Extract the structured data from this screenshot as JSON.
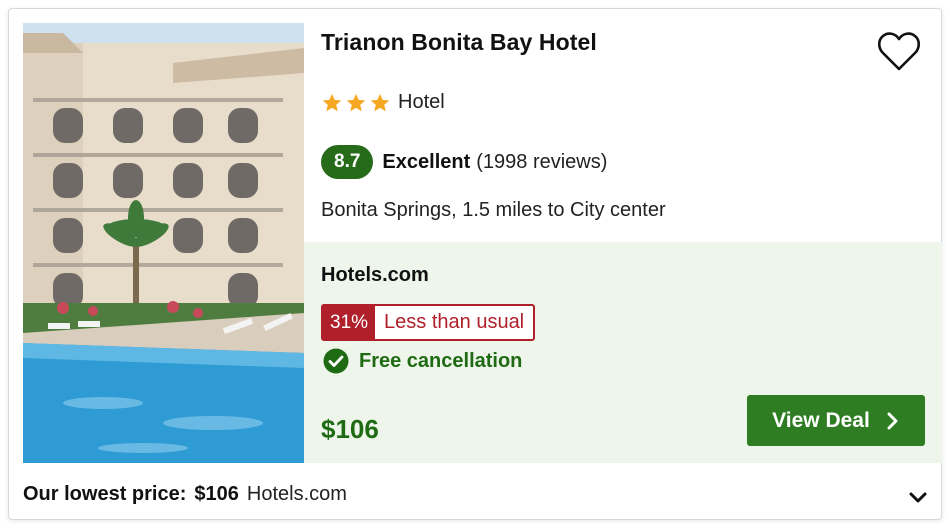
{
  "hotel": {
    "name": "Trianon Bonita Bay Hotel",
    "star_rating": 3,
    "type": "Hotel",
    "score": "8.7",
    "rating_word": "Excellent",
    "reviews": "(1998 reviews)",
    "location": "Bonita Springs, 1.5 miles to City center"
  },
  "deal": {
    "provider": "Hotels.com",
    "discount_pct": "31%",
    "discount_label": "Less than usual",
    "free_cancellation": "Free cancellation",
    "price": "$106",
    "view_deal_label": "View Deal"
  },
  "footer": {
    "lowest_label": "Our lowest price:",
    "lowest_price": "$106",
    "lowest_provider": "Hotels.com"
  },
  "icons": {
    "favorite": "heart-outline-icon",
    "star": "star-icon",
    "check": "check-circle-icon",
    "chevron_right": "chevron-right-icon",
    "chevron_down": "chevron-down-icon"
  },
  "colors": {
    "score_bg": "#256b1a",
    "accent_green": "#1f6b14",
    "button_green": "#2f7d22",
    "deal_bg": "#eef5ea",
    "discount_red": "#b0202a",
    "star": "#f5a623"
  }
}
